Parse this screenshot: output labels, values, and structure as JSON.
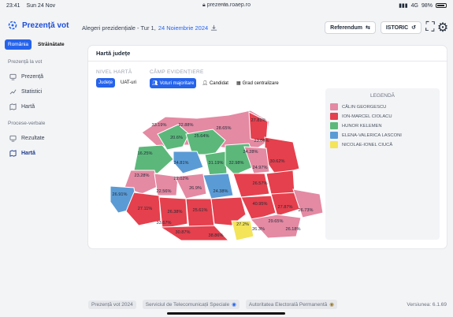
{
  "status_bar": {
    "time": "23:41",
    "date": "Sun 24 Nov",
    "url": "prezenta.roaep.ro",
    "network": "4G",
    "battery": "98%"
  },
  "brand": {
    "title": "Prezență vot"
  },
  "segment": {
    "romania": "România",
    "abroad": "Străinătate"
  },
  "sidebar": {
    "section1": "Prezență la vot",
    "items1": [
      {
        "label": "Prezență",
        "icon": "monitor-icon"
      },
      {
        "label": "Statistici",
        "icon": "trend-icon"
      },
      {
        "label": "Hartă",
        "icon": "map-icon"
      }
    ],
    "section2": "Procese-verbale",
    "items2": [
      {
        "label": "Rezultate",
        "icon": "monitor-icon"
      },
      {
        "label": "Hartă",
        "icon": "map-icon"
      }
    ]
  },
  "topbar": {
    "title": "Alegeri prezidențiale - Tur 1,",
    "date": "24 Noiembrie 2024",
    "referendum": "Referendum",
    "istoric": "ISTORIC"
  },
  "card": {
    "title": "Hartă județe",
    "level_label": "NIVEL HARTĂ",
    "level_options": [
      "Județe",
      "UAT-uri"
    ],
    "highlight_label": "CÂMP EVIDENȚIERE",
    "highlight_options": [
      "Voturi majoritare",
      "Candidat",
      "Grad centralizare"
    ]
  },
  "legend": {
    "title": "LEGENDĂ",
    "items": [
      {
        "name": "CĂLIN GEORGESCU",
        "color": "#e48aa3"
      },
      {
        "name": "ION-MARCEL CIOLACU",
        "color": "#e5404d"
      },
      {
        "name": "HUNOR KELEMEN",
        "color": "#5cb87a"
      },
      {
        "name": "ELENA-VALERICA LASCONI",
        "color": "#5b9bd5"
      },
      {
        "name": "NICOLAE-IONEL CIUCĂ",
        "color": "#f3e45a"
      }
    ]
  },
  "map_labels": [
    "33.19%",
    "22.88%",
    "28.65%",
    "27.81%",
    "20.6%",
    "25.64%",
    "23.08%",
    "16.25%",
    "24.81%",
    "31.19%",
    "32.98%",
    "24.28%",
    "30.62%",
    "23.28%",
    "22.02%",
    "24.97%",
    "26.91%",
    "22.56%",
    "26.9%",
    "24.38%",
    "26.57%",
    "27.11%",
    "26.38%",
    "25.61%",
    "40.95%",
    "27.87%",
    "26.73%",
    "33.67%",
    "29.65%",
    "30.87%",
    "38.86%",
    "26.3%",
    "26.18%",
    "27.2%"
  ],
  "footer": {
    "presence": "Prezență vot 2024",
    "telecom": "Serviciul de Telecomunicații Speciale",
    "authority": "Autoritatea Electorală Permanentă",
    "version": "Versiunea: 6.1.69"
  }
}
